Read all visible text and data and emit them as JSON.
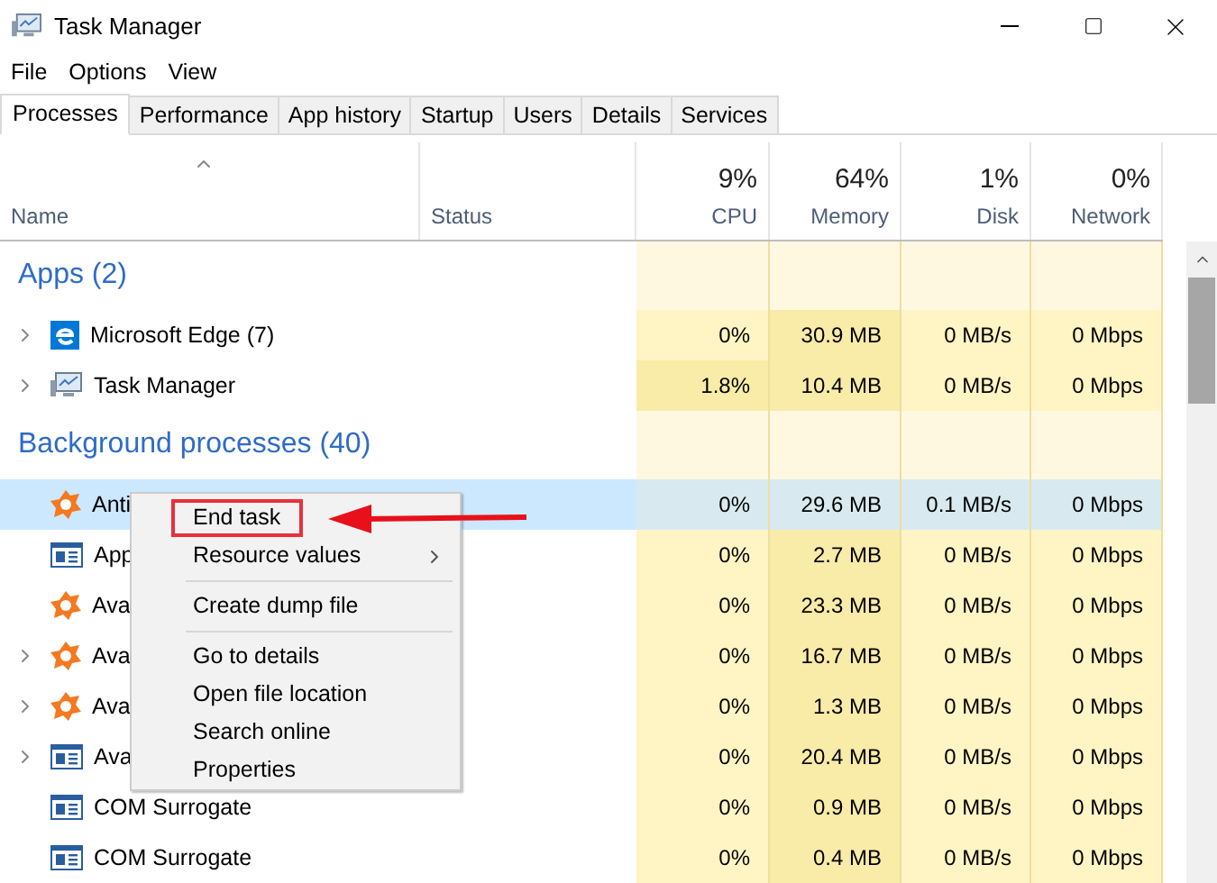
{
  "window": {
    "title": "Task Manager"
  },
  "menu": [
    "File",
    "Options",
    "View"
  ],
  "tabs": [
    {
      "label": "Processes",
      "selected": true
    },
    {
      "label": "Performance",
      "selected": false
    },
    {
      "label": "App history",
      "selected": false
    },
    {
      "label": "Startup",
      "selected": false
    },
    {
      "label": "Users",
      "selected": false
    },
    {
      "label": "Details",
      "selected": false
    },
    {
      "label": "Services",
      "selected": false
    }
  ],
  "columns": {
    "name": "Name",
    "status": "Status",
    "cpu": {
      "total": "9%",
      "label": "CPU"
    },
    "memory": {
      "total": "64%",
      "label": "Memory"
    },
    "disk": {
      "total": "1%",
      "label": "Disk"
    },
    "network": {
      "total": "0%",
      "label": "Network"
    }
  },
  "groups": [
    {
      "title": "Apps (2)",
      "rows": [
        {
          "name": "Microsoft Edge (7)",
          "kind": "edge",
          "expandable": true,
          "selected": false,
          "cpu_busy": false,
          "cpu": "0%",
          "memory": "30.9 MB",
          "disk": "0 MB/s",
          "network": "0 Mbps"
        },
        {
          "name": "Task Manager",
          "kind": "monitor",
          "expandable": true,
          "selected": false,
          "cpu_busy": true,
          "cpu": "1.8%",
          "memory": "10.4 MB",
          "disk": "0 MB/s",
          "network": "0 Mbps"
        }
      ]
    },
    {
      "title": "Background processes (40)",
      "rows": [
        {
          "name": "Anti",
          "kind": "shield",
          "expandable": false,
          "selected": true,
          "cpu_busy": false,
          "cpu": "0%",
          "memory": "29.6 MB",
          "disk": "0.1 MB/s",
          "network": "0 Mbps"
        },
        {
          "name": "App",
          "kind": "window",
          "expandable": false,
          "selected": false,
          "cpu_busy": false,
          "cpu": "0%",
          "memory": "2.7 MB",
          "disk": "0 MB/s",
          "network": "0 Mbps"
        },
        {
          "name": "Ava",
          "kind": "shield",
          "expandable": false,
          "selected": false,
          "cpu_busy": false,
          "cpu": "0%",
          "memory": "23.3 MB",
          "disk": "0 MB/s",
          "network": "0 Mbps"
        },
        {
          "name": "Ava",
          "kind": "shield",
          "expandable": true,
          "selected": false,
          "cpu_busy": false,
          "cpu": "0%",
          "memory": "16.7 MB",
          "disk": "0 MB/s",
          "network": "0 Mbps"
        },
        {
          "name": "Ava",
          "kind": "shield",
          "expandable": true,
          "selected": false,
          "cpu_busy": false,
          "cpu": "0%",
          "memory": "1.3 MB",
          "disk": "0 MB/s",
          "network": "0 Mbps"
        },
        {
          "name": "Ava",
          "kind": "window",
          "expandable": true,
          "selected": false,
          "cpu_busy": false,
          "cpu": "0%",
          "memory": "20.4 MB",
          "disk": "0 MB/s",
          "network": "0 Mbps"
        },
        {
          "name": "COM Surrogate",
          "kind": "window",
          "expandable": false,
          "selected": false,
          "cpu_busy": false,
          "cpu": "0%",
          "memory": "0.9 MB",
          "disk": "0 MB/s",
          "network": "0 Mbps"
        },
        {
          "name": "COM Surrogate",
          "kind": "window",
          "expandable": false,
          "selected": false,
          "cpu_busy": false,
          "cpu": "0%",
          "memory": "0.4 MB",
          "disk": "0 MB/s",
          "network": "0 Mbps"
        }
      ]
    }
  ],
  "context_menu": [
    {
      "kind": "item",
      "label": "End task",
      "highlighted": true
    },
    {
      "kind": "submenu",
      "label": "Resource values",
      "highlighted": false
    },
    {
      "kind": "separator"
    },
    {
      "kind": "item",
      "label": "Create dump file",
      "highlighted": false
    },
    {
      "kind": "separator"
    },
    {
      "kind": "item",
      "label": "Go to details",
      "highlighted": false
    },
    {
      "kind": "item",
      "label": "Open file location",
      "highlighted": false
    },
    {
      "kind": "item",
      "label": "Search online",
      "highlighted": false
    },
    {
      "kind": "item",
      "label": "Properties",
      "highlighted": false
    }
  ]
}
